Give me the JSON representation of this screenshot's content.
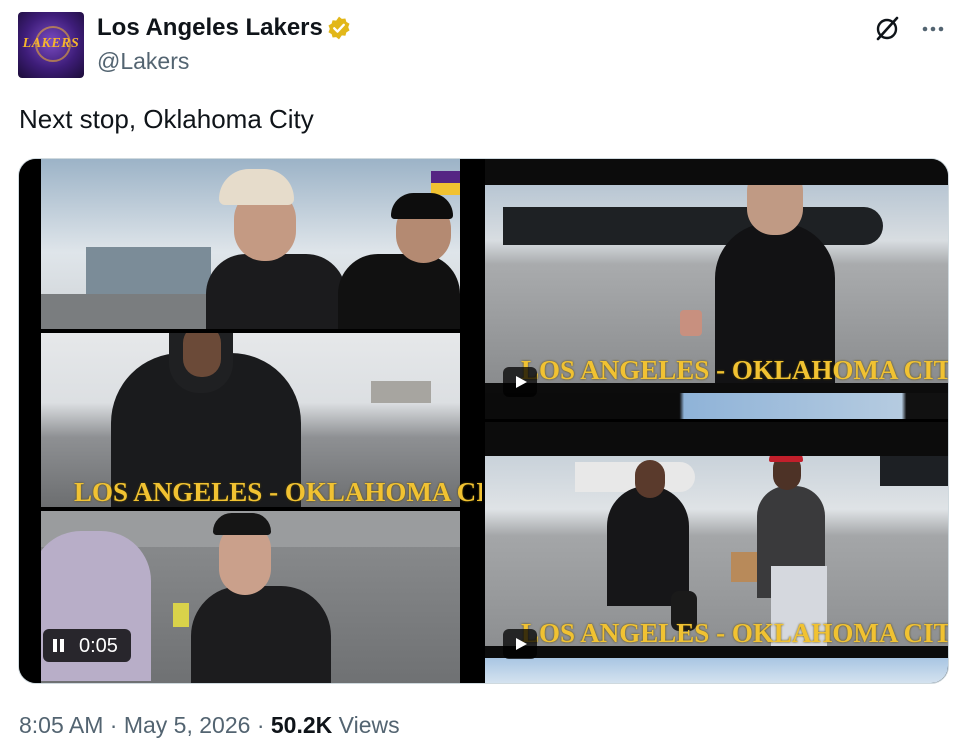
{
  "author": {
    "name": "Los Angeles Lakers",
    "handle": "@Lakers",
    "avatar_text": "LAKERS"
  },
  "tweet": {
    "text": "Next stop, Oklahoma City"
  },
  "media": {
    "video1": {
      "overlay": "LOS ANGELES  - OKLAHOMA CITY",
      "timestamp": "0:05"
    },
    "video2": {
      "overlay": "LOS ANGELES  - OKLAHOMA CITY"
    },
    "video3": {
      "overlay": "LOS ANGELES  - OKLAHOMA CITY"
    }
  },
  "footer": {
    "time": "8:05 AM",
    "sep1": " · ",
    "date": "May 5, 2026",
    "sep2": " · ",
    "views_count": "50.2K",
    "views_label": " Views"
  },
  "colors": {
    "verified_gold": "#e2b719",
    "overlay_gold": "#f1c232",
    "lakers_purple": "#552583"
  },
  "icons": [
    "verified-badge-icon",
    "grok-icon",
    "more-icon",
    "play-icon",
    "pause-icon"
  ]
}
